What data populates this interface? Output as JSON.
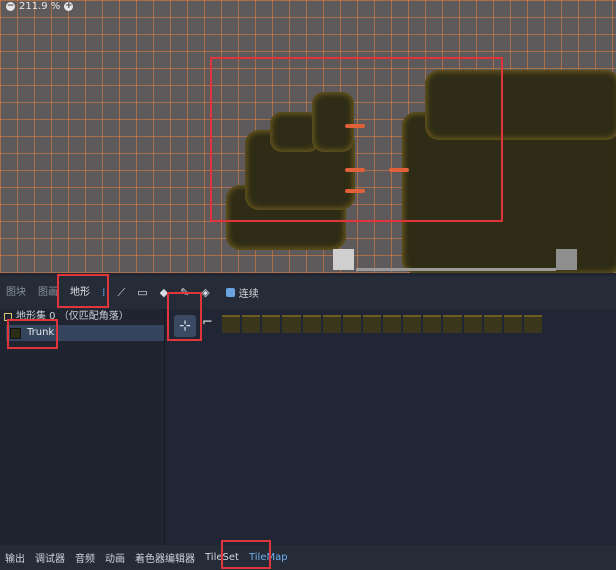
{
  "viewport": {
    "zoom_label": "211.9 %"
  },
  "tilemap_panel": {
    "tabs": [
      "图块",
      "图画",
      "地形"
    ],
    "active_tab": "地形",
    "connect_checkbox_label": "连续",
    "terrain_set_label": "地形集 0 （仅匹配角落）",
    "terrain_item_label": "Trunk"
  },
  "bottom_bar": {
    "tabs": [
      "输出",
      "调试器",
      "音频",
      "动画",
      "着色器编辑器",
      "TileSet",
      "TileMap"
    ],
    "active_tab": "TileMap"
  },
  "colors": {
    "highlight_red": "#e0353a",
    "accent_blue": "#6fb0f0"
  }
}
